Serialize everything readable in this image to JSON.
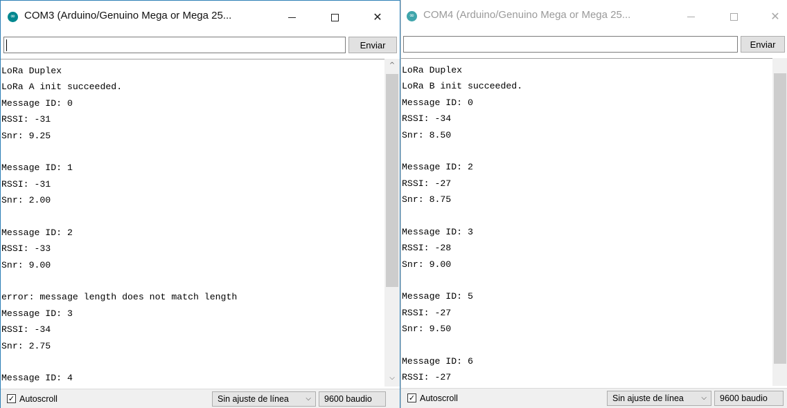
{
  "windows": [
    {
      "title": "COM3 (Arduino/Genuino Mega or Mega 25...",
      "controls": {
        "minimize": "—",
        "maximize": "☐",
        "close": "✕"
      },
      "send_input_value": "",
      "send_button": "Enviar",
      "console_lines": [
        "LoRa Duplex",
        "LoRa A init succeeded.",
        "Message ID: 0",
        "RSSI: -31",
        "Snr: 9.25",
        "",
        "Message ID: 1",
        "RSSI: -31",
        "Snr: 2.00",
        "",
        "Message ID: 2",
        "RSSI: -33",
        "Snr: 9.00",
        "",
        "error: message length does not match length",
        "Message ID: 3",
        "RSSI: -34",
        "Snr: 2.75",
        "",
        "Message ID: 4"
      ],
      "scroll_up_icon": "chevron-up-icon",
      "scroll_down_icon": "chevron-down-icon",
      "autoscroll_label": "Autoscroll",
      "autoscroll_checked": true,
      "line_ending": "Sin ajuste de línea",
      "baud_rate": "9600 baudio",
      "active": true
    },
    {
      "title": "COM4 (Arduino/Genuino Mega or Mega 25...",
      "controls": {
        "minimize": "—",
        "maximize": "☐",
        "close": "✕"
      },
      "send_input_value": "",
      "send_button": "Enviar",
      "console_lines": [
        "LoRa Duplex",
        "LoRa B init succeeded.",
        "Message ID: 0",
        "RSSI: -34",
        "Snr: 8.50",
        "",
        "Message ID: 2",
        "RSSI: -27",
        "Snr: 8.75",
        "",
        "Message ID: 3",
        "RSSI: -28",
        "Snr: 9.00",
        "",
        "Message ID: 5",
        "RSSI: -27",
        "Snr: 9.50",
        "",
        "Message ID: 6",
        "RSSI: -27"
      ],
      "autoscroll_label": "Autoscroll",
      "autoscroll_checked": true,
      "line_ending": "Sin ajuste de línea",
      "baud_rate": "9600 baudio",
      "active": false
    }
  ],
  "icons": {
    "app": "arduino-logo-icon",
    "check": "✓",
    "chevron_down": "⌵",
    "chevron_up": "^"
  },
  "colors": {
    "active_border": "#2d7fb6",
    "arduino_teal": "#00878f",
    "inactive_title": "#9a9a9a"
  }
}
